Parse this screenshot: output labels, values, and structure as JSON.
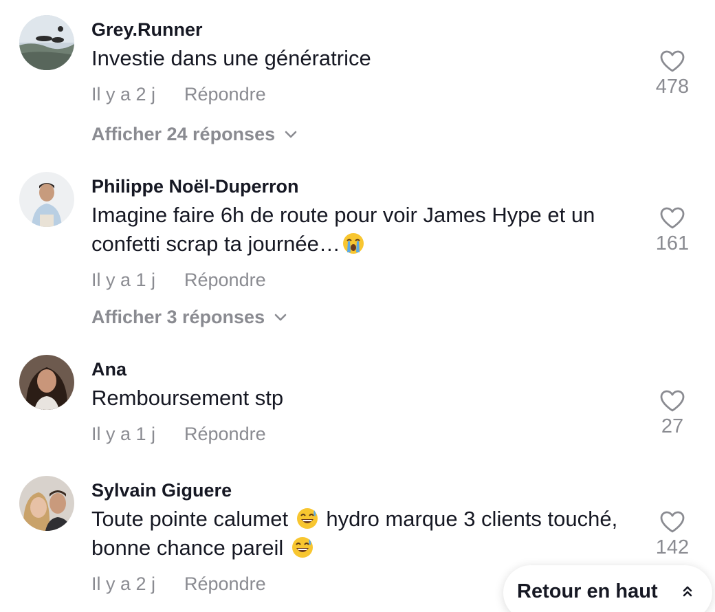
{
  "comments": [
    {
      "username": "Grey.Runner",
      "text": "Investie dans une génératrice",
      "time": "Il y a 2 j",
      "reply_label": "Répondre",
      "replies_label": "Afficher 24 réponses",
      "likes": "478",
      "avatar": "skydiving-photo"
    },
    {
      "username": "Philippe Noël-Duperron",
      "text_parts": [
        "Imagine faire 6h de route pour voir James Hype et un confetti scrap ta journée…"
      ],
      "emoji_1": "loudly-crying-face",
      "time": "Il y a 1 j",
      "reply_label": "Répondre",
      "replies_label": "Afficher 3 réponses",
      "likes": "161",
      "avatar": "man-white-shirt"
    },
    {
      "username": "Ana",
      "text": "Remboursement stp",
      "time": "Il y a 1 j",
      "reply_label": "Répondre",
      "likes": "27",
      "avatar": "woman-portrait"
    },
    {
      "username": "Sylvain Giguere",
      "text_parts": [
        "Toute pointe calumet",
        "hydro marque 3 clients touché, bonne chance pareil"
      ],
      "emoji_1": "grinning-sweat-face",
      "time": "Il y a 2 j",
      "reply_label": "Répondre",
      "likes": "142",
      "avatar": "couple-selfie"
    }
  ],
  "back_to_top": {
    "label": "Retour en haut",
    "icon": "double-chevron-up-icon"
  },
  "colors": {
    "text": "#161823",
    "muted": "#8a8b91",
    "background": "#ffffff"
  }
}
